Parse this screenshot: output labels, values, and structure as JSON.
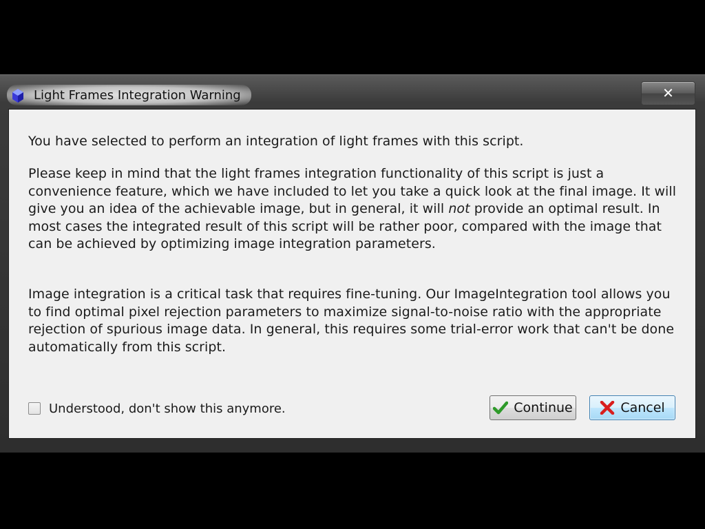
{
  "window": {
    "title": "Light Frames Integration Warning",
    "close_glyph": "✕",
    "icon": "pixinsight-app-icon"
  },
  "message": {
    "paragraph1": "You have selected to perform an integration of light frames with this script.",
    "paragraph2_before_em": "Please keep in mind that the light frames integration functionality of this script is just a convenience feature, which we have included to let you take a quick look at the final image. It will give you an idea of the achievable image, but in general, it will ",
    "paragraph2_em": "not",
    "paragraph2_after_em": " provide an optimal result. In most cases the integrated result of this script will be rather poor, compared with the image that can be achieved by optimizing image integration parameters.",
    "paragraph3": "Image integration is a critical task that requires fine-tuning. Our ImageIntegration tool allows you to find optimal pixel rejection parameters to maximize signal-to-noise ratio with the appropriate rejection of spurious image data. In general, this requires some trial-error work that can't be done automatically from this script."
  },
  "options": {
    "dont_show_label": "Understood, don't show this anymore.",
    "dont_show_checked": false
  },
  "buttons": {
    "continue_label": "Continue",
    "continue_icon": "check-icon",
    "cancel_label": "Cancel",
    "cancel_icon": "x-icon"
  },
  "colors": {
    "check_green": "#2e9a2a",
    "cancel_red": "#d81e1e",
    "default_button_border": "#3c7fb1"
  }
}
